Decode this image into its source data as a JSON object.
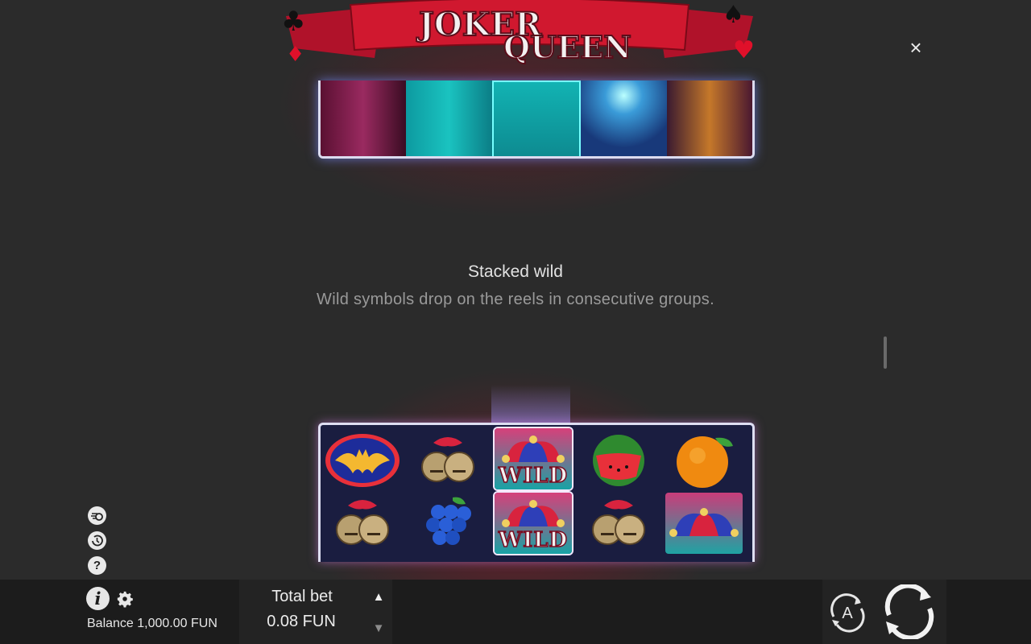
{
  "game": {
    "title_line1": "JOKER",
    "title_line2": "QUEEN"
  },
  "feature": {
    "title": "Stacked wild",
    "description": "Wild symbols drop on the reels in consecutive groups."
  },
  "reels": {
    "wild_label": "WILD",
    "columns": [
      [
        "bat-emblem",
        "bells"
      ],
      [
        "bells",
        "grapes"
      ],
      [
        "wild-jester",
        "wild-jester"
      ],
      [
        "watermelon",
        "bells"
      ],
      [
        "orange",
        "jester-hat"
      ]
    ]
  },
  "close": {
    "symbol": "×"
  },
  "help": {
    "symbol": "?"
  },
  "info": {
    "symbol": "i"
  },
  "balance": {
    "text": "Balance 1,000.00 FUN"
  },
  "bet": {
    "label": "Total bet",
    "value": "0.08 FUN",
    "up_symbol": "▲",
    "down_symbol": "▼"
  },
  "autoplay": {
    "label": "A"
  },
  "colors": {
    "accent_red": "#c0142e",
    "frame_glow": "#7c8cff",
    "bar_bg": "#1c1c1c"
  }
}
